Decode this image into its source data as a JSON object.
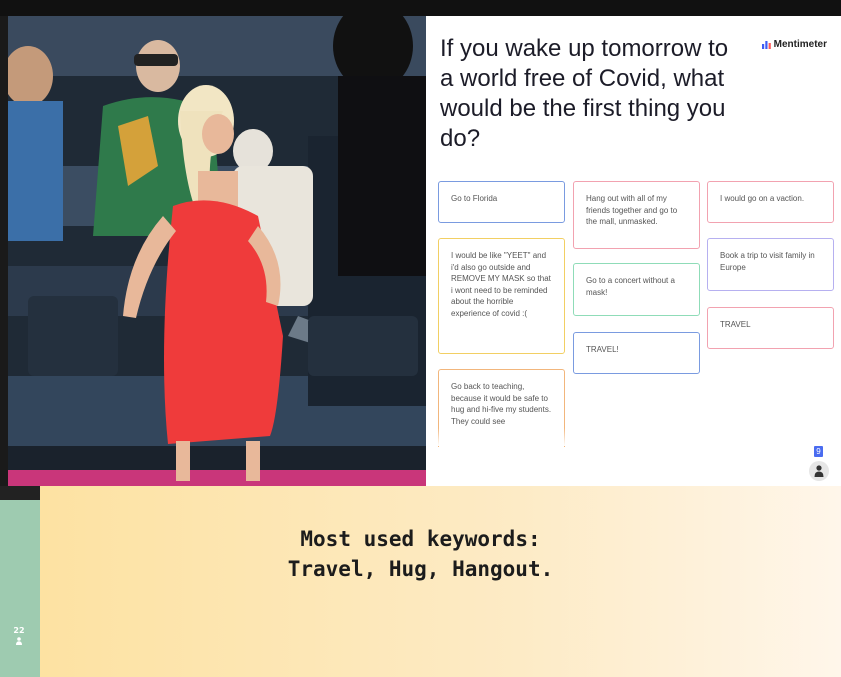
{
  "slide": {
    "title": "If you wake up tomorrow to a world free of Covid, what would be the first thing you do?",
    "brand": "Mentimeter",
    "participants": "9",
    "responses": [
      {
        "text": "Go to Florida",
        "color": "#7a9be0"
      },
      {
        "text": "Hang out with all of my friends together and go to the mall, unmasked.",
        "color": "#f2a2b0"
      },
      {
        "text": "I would go on a vaction.",
        "color": "#f2a2b0"
      },
      {
        "text": "I would be like \"YEET\" and i'd also go outside and REMOVE MY MASK so that i wont need to be reminded about the horrible experience of covid :(",
        "color": "#f2cf63"
      },
      {
        "text": "Go to a concert without a mask!",
        "color": "#8fdcb8"
      },
      {
        "text": "Book a trip to visit family in Europe",
        "color": "#b6b0f0"
      },
      {
        "text": "TRAVEL",
        "color": "#f2a2b0"
      },
      {
        "text": "TRAVEL!",
        "color": "#7a9be0"
      },
      {
        "text": "Go back to teaching, because it would be safe to hug and hi-five my students. They could see",
        "color": "#f2b67c"
      }
    ]
  },
  "sidebar": {
    "participants": "22"
  },
  "caption": {
    "line1": "Most used keywords:",
    "line2": "Travel, Hug, Hangout."
  }
}
